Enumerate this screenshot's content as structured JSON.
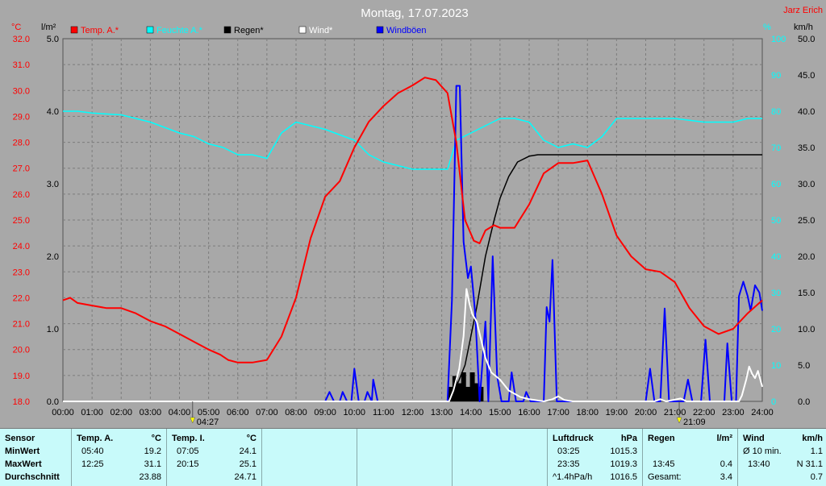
{
  "title": "Montag, 17.07.2023",
  "brand": "Jarz Erich",
  "axis_units": {
    "celsius_left": "°C",
    "rain_left": "l/m²",
    "percent_right": "%",
    "wind_right": "km/h"
  },
  "legend": [
    {
      "label": "Temp. A.*",
      "color": "#ff0000"
    },
    {
      "label": "Feuchte A.*",
      "color": "#00ffff"
    },
    {
      "label": "Regen*",
      "color": "#000000"
    },
    {
      "label": "Wind*",
      "color": "#ffffff"
    },
    {
      "label": "Windböen",
      "color": "#0000ff"
    }
  ],
  "sun": {
    "sunrise": "04:27",
    "sunset": "21:09"
  },
  "chart_data": {
    "type": "line",
    "title": "Montag, 17.07.2023",
    "x_ticks": [
      "00:00",
      "01:00",
      "02:00",
      "03:00",
      "04:00",
      "05:00",
      "06:00",
      "07:00",
      "08:00",
      "09:00",
      "10:00",
      "11:00",
      "12:00",
      "13:00",
      "14:00",
      "15:00",
      "16:00",
      "17:00",
      "18:00",
      "19:00",
      "20:00",
      "21:00",
      "22:00",
      "23:00",
      "24:00"
    ],
    "xlim": [
      0,
      24
    ],
    "axes": {
      "temperature": {
        "label": "°C",
        "ylim": [
          18,
          32
        ],
        "ticks": [
          "32.0",
          "31.0",
          "30.0",
          "29.0",
          "28.0",
          "27.0",
          "26.0",
          "25.0",
          "24.0",
          "23.0",
          "22.0",
          "21.0",
          "20.0",
          "19.0",
          "18.0"
        ]
      },
      "rain": {
        "label": "l/m²",
        "ylim": [
          0,
          5
        ],
        "ticks": [
          "5.0",
          "4.0",
          "3.0",
          "2.0",
          "1.0",
          "0.0"
        ]
      },
      "humidity": {
        "label": "%",
        "ylim": [
          0,
          100
        ],
        "ticks": [
          "100",
          "90",
          "80",
          "70",
          "60",
          "50",
          "40",
          "30",
          "20",
          "10",
          "0"
        ]
      },
      "wind": {
        "label": "km/h",
        "ylim": [
          0,
          50
        ],
        "ticks": [
          "50.0",
          "45.0",
          "40.0",
          "35.0",
          "30.0",
          "25.0",
          "20.0",
          "15.0",
          "10.0",
          "5.0",
          "0.0"
        ]
      }
    },
    "grid": true,
    "series": [
      {
        "name": "Temp. A.*",
        "axis": "temperature",
        "color": "#ff0000",
        "points": [
          [
            0,
            21.9
          ],
          [
            0.25,
            22.0
          ],
          [
            0.5,
            21.8
          ],
          [
            1,
            21.7
          ],
          [
            1.5,
            21.6
          ],
          [
            2,
            21.6
          ],
          [
            2.5,
            21.4
          ],
          [
            3,
            21.1
          ],
          [
            3.5,
            20.9
          ],
          [
            4,
            20.6
          ],
          [
            4.5,
            20.3
          ],
          [
            5,
            20.0
          ],
          [
            5.4,
            19.8
          ],
          [
            5.67,
            19.6
          ],
          [
            6,
            19.5
          ],
          [
            6.5,
            19.5
          ],
          [
            7,
            19.6
          ],
          [
            7.5,
            20.5
          ],
          [
            8,
            22.0
          ],
          [
            8.5,
            24.3
          ],
          [
            9,
            25.9
          ],
          [
            9.5,
            26.5
          ],
          [
            10,
            27.8
          ],
          [
            10.5,
            28.8
          ],
          [
            11,
            29.4
          ],
          [
            11.5,
            29.9
          ],
          [
            12,
            30.2
          ],
          [
            12.42,
            30.5
          ],
          [
            12.8,
            30.4
          ],
          [
            13.2,
            29.9
          ],
          [
            13.5,
            28.0
          ],
          [
            13.8,
            25.0
          ],
          [
            14.1,
            24.2
          ],
          [
            14.3,
            24.1
          ],
          [
            14.5,
            24.6
          ],
          [
            14.8,
            24.8
          ],
          [
            15,
            24.7
          ],
          [
            15.5,
            24.7
          ],
          [
            16,
            25.6
          ],
          [
            16.5,
            26.8
          ],
          [
            17,
            27.2
          ],
          [
            17.5,
            27.2
          ],
          [
            18,
            27.3
          ],
          [
            18.5,
            26.0
          ],
          [
            19,
            24.4
          ],
          [
            19.5,
            23.6
          ],
          [
            20,
            23.1
          ],
          [
            20.5,
            23.0
          ],
          [
            21,
            22.6
          ],
          [
            21.5,
            21.6
          ],
          [
            22,
            20.9
          ],
          [
            22.5,
            20.6
          ],
          [
            23,
            20.8
          ],
          [
            23.5,
            21.4
          ],
          [
            24,
            21.9
          ]
        ]
      },
      {
        "name": "Feuchte A.*",
        "axis": "humidity",
        "color": "#00ffff",
        "points": [
          [
            0,
            80
          ],
          [
            0.5,
            80
          ],
          [
            1,
            79.5
          ],
          [
            2,
            79
          ],
          [
            3,
            77
          ],
          [
            4,
            74
          ],
          [
            4.5,
            73
          ],
          [
            5,
            71
          ],
          [
            5.5,
            70
          ],
          [
            6,
            68
          ],
          [
            6.5,
            68
          ],
          [
            7,
            67
          ],
          [
            7.5,
            74
          ],
          [
            8,
            77
          ],
          [
            8.5,
            76
          ],
          [
            9,
            75
          ],
          [
            10,
            72
          ],
          [
            10.5,
            68
          ],
          [
            11,
            66
          ],
          [
            12,
            64
          ],
          [
            12.5,
            64
          ],
          [
            13,
            64
          ],
          [
            13.2,
            64
          ],
          [
            13.5,
            72
          ],
          [
            14,
            74
          ],
          [
            14.5,
            76
          ],
          [
            15,
            78
          ],
          [
            15.5,
            78
          ],
          [
            16,
            77
          ],
          [
            16.5,
            72
          ],
          [
            17,
            70
          ],
          [
            17.5,
            71
          ],
          [
            18,
            70
          ],
          [
            18.5,
            73
          ],
          [
            19,
            78
          ],
          [
            20,
            78
          ],
          [
            21,
            78
          ],
          [
            22,
            77
          ],
          [
            23,
            77
          ],
          [
            23.5,
            78
          ],
          [
            24,
            78
          ]
        ]
      },
      {
        "name": "Regen*",
        "axis": "rain",
        "color": "#000000",
        "points": [
          [
            0,
            0
          ],
          [
            13.2,
            0
          ],
          [
            13.4,
            0.1
          ],
          [
            13.6,
            0.3
          ],
          [
            13.8,
            0.5
          ],
          [
            14,
            0.9
          ],
          [
            14.2,
            1.3
          ],
          [
            14.5,
            2.0
          ],
          [
            14.8,
            2.5
          ],
          [
            15,
            2.8
          ],
          [
            15.3,
            3.1
          ],
          [
            15.6,
            3.3
          ],
          [
            16,
            3.38
          ],
          [
            16.3,
            3.4
          ],
          [
            17,
            3.4
          ],
          [
            24,
            3.4
          ]
        ]
      },
      {
        "name": "Wind*",
        "axis": "wind",
        "color": "#ffffff",
        "points": [
          [
            0,
            0
          ],
          [
            13.25,
            0
          ],
          [
            13.4,
            1.5
          ],
          [
            13.6,
            4.5
          ],
          [
            13.75,
            9.0
          ],
          [
            13.85,
            15.5
          ],
          [
            13.95,
            13.5
          ],
          [
            14.05,
            12.0
          ],
          [
            14.2,
            11.0
          ],
          [
            14.35,
            8.5
          ],
          [
            14.5,
            6.0
          ],
          [
            14.7,
            4.0
          ],
          [
            15,
            3.0
          ],
          [
            15.3,
            1.5
          ],
          [
            15.7,
            0.6
          ],
          [
            16,
            0.3
          ],
          [
            16.5,
            0
          ],
          [
            16.8,
            0.3
          ],
          [
            17.0,
            0.7
          ],
          [
            17.2,
            0.2
          ],
          [
            17.5,
            0
          ],
          [
            20.3,
            0
          ],
          [
            20.5,
            0.3
          ],
          [
            20.7,
            0
          ],
          [
            21.2,
            0.4
          ],
          [
            21.4,
            0
          ],
          [
            23.2,
            0
          ],
          [
            23.3,
            0.8
          ],
          [
            23.45,
            3.0
          ],
          [
            23.55,
            4.8
          ],
          [
            23.65,
            3.8
          ],
          [
            23.75,
            3.2
          ],
          [
            23.85,
            4.2
          ],
          [
            24,
            2.0
          ]
        ]
      },
      {
        "name": "Windböen",
        "axis": "wind",
        "color": "#0000ff",
        "points": [
          [
            0,
            0
          ],
          [
            9,
            0
          ],
          [
            9.15,
            1.3
          ],
          [
            9.3,
            0
          ],
          [
            9.5,
            0
          ],
          [
            9.6,
            1.3
          ],
          [
            9.75,
            0
          ],
          [
            9.9,
            0
          ],
          [
            10.0,
            4.5
          ],
          [
            10.15,
            0
          ],
          [
            10.35,
            0
          ],
          [
            10.45,
            1.3
          ],
          [
            10.6,
            0
          ],
          [
            10.65,
            3.0
          ],
          [
            10.8,
            0
          ],
          [
            13.2,
            0
          ],
          [
            13.35,
            14
          ],
          [
            13.5,
            43.5
          ],
          [
            13.62,
            43.5
          ],
          [
            13.75,
            22
          ],
          [
            13.9,
            17
          ],
          [
            14.0,
            18.6
          ],
          [
            14.15,
            12
          ],
          [
            14.3,
            0
          ],
          [
            14.5,
            11
          ],
          [
            14.6,
            0
          ],
          [
            14.75,
            20
          ],
          [
            14.9,
            3.5
          ],
          [
            15.05,
            0
          ],
          [
            15.3,
            0
          ],
          [
            15.4,
            4.0
          ],
          [
            15.55,
            0
          ],
          [
            15.8,
            0
          ],
          [
            15.9,
            1.3
          ],
          [
            16.05,
            0
          ],
          [
            16.5,
            0
          ],
          [
            16.6,
            13
          ],
          [
            16.7,
            11
          ],
          [
            16.8,
            19.5
          ],
          [
            16.95,
            0
          ],
          [
            20.0,
            0
          ],
          [
            20.15,
            4.5
          ],
          [
            20.3,
            0
          ],
          [
            20.5,
            0
          ],
          [
            20.65,
            12.8
          ],
          [
            20.8,
            0
          ],
          [
            21.3,
            0
          ],
          [
            21.45,
            3.0
          ],
          [
            21.6,
            0
          ],
          [
            21.9,
            0
          ],
          [
            22.05,
            8.5
          ],
          [
            22.2,
            0
          ],
          [
            22.7,
            0
          ],
          [
            22.8,
            8.0
          ],
          [
            22.95,
            0
          ],
          [
            23.1,
            0
          ],
          [
            23.2,
            14.5
          ],
          [
            23.35,
            16.5
          ],
          [
            23.5,
            14.5
          ],
          [
            23.6,
            12.5
          ],
          [
            23.75,
            16.0
          ],
          [
            23.9,
            15.0
          ],
          [
            24,
            12.5
          ]
        ]
      }
    ],
    "bars": {
      "name": "Regen* (5-min)",
      "axis": "rain",
      "color": "#000000",
      "x": [
        13.3,
        13.45,
        13.6,
        13.75,
        13.9,
        14.05,
        14.2,
        14.35
      ],
      "values": [
        0.2,
        0.35,
        0.25,
        0.4,
        0.2,
        0.4,
        0.25,
        0.2
      ]
    }
  },
  "table": {
    "row_labels": [
      "Sensor",
      "MinWert",
      "MaxWert",
      "Durchschnitt"
    ],
    "temp_a": {
      "header": "Temp. A.",
      "unit": "°C",
      "min_time": "05:40",
      "min": "19.2",
      "max_time": "12:25",
      "max": "31.1",
      "avg": "23.88"
    },
    "temp_i": {
      "header": "Temp. I.",
      "unit": "°C",
      "min_time": "07:05",
      "min": "24.1",
      "max_time": "20:15",
      "max": "25.1",
      "avg": "24.71"
    },
    "pressure": {
      "header": "Luftdruck",
      "unit": "hPa",
      "min_time": "03:25",
      "min": "1015.3",
      "max_time": "23:35",
      "max": "1019.3",
      "avg_label": "^1.4hPa/h",
      "avg": "1016.5"
    },
    "rain": {
      "header": "Regen",
      "unit": "l/m²",
      "max_time": "13:45",
      "max": "0.4",
      "total_label": "Gesamt:",
      "total": "3.4"
    },
    "wind": {
      "header": "Wind",
      "unit": "km/h",
      "min_label": "Ø 10 min.",
      "min": "1.1",
      "max_time": "13:40",
      "max": "N 31.1",
      "avg": "0.7"
    }
  }
}
